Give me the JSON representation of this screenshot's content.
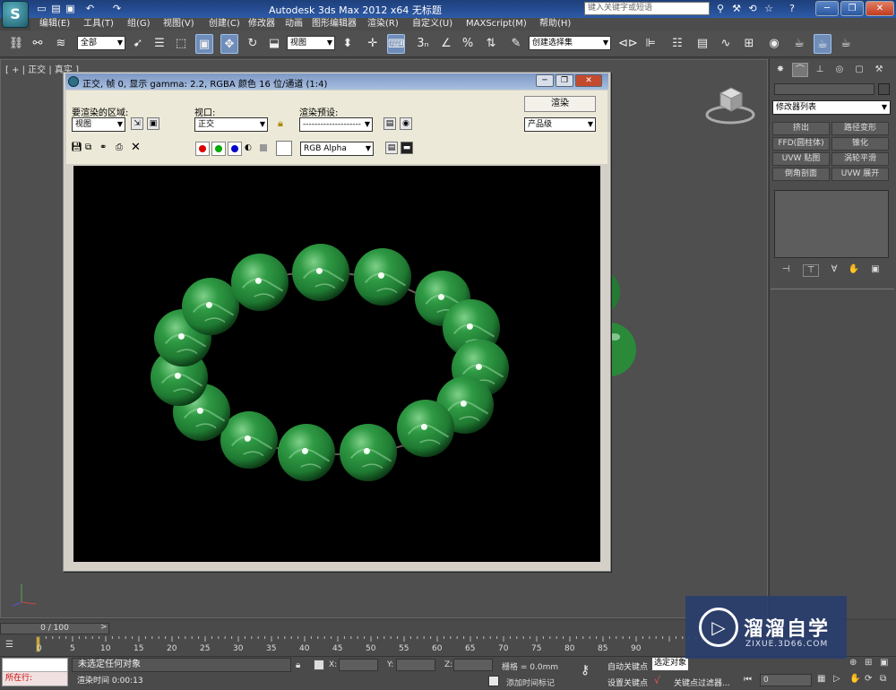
{
  "app": {
    "title": "Autodesk 3ds Max  2012 x64      无标题",
    "logo_text": "S",
    "search_placeholder": "键入关键字或短语"
  },
  "menus": [
    "编辑(E)",
    "工具(T)",
    "组(G)",
    "视图(V)",
    "创建(C)",
    "修改器",
    "动画",
    "图形编辑器",
    "渲染(R)",
    "自定义(U)",
    "MAXScript(M)",
    "帮助(H)"
  ],
  "toolbar": {
    "selection_filter": "全部",
    "ref_coord": "视图",
    "named_selection": "创建选择集"
  },
  "viewport": {
    "label": "[ + | 正交 | 真实 ]"
  },
  "render_frame": {
    "title": "正交, 帧 0, 显示 gamma: 2.2, RGBA 颜色 16 位/通道 (1:4)",
    "area_label": "要渲染的区域:",
    "area_value": "视图",
    "viewport_label": "视口:",
    "viewport_value": "正交",
    "preset_label": "渲染预设:",
    "preset_value": "--------------------",
    "render_button": "渲染",
    "production_value": "产品级",
    "channel_value": "RGB Alpha",
    "channel_colors": [
      "#dd0000",
      "#00a000",
      "#0000cc"
    ]
  },
  "command_panel": {
    "modifier_list": "修改器列表",
    "modifiers": [
      "挤出",
      "路径变形",
      "FFD(圆柱体)",
      "锥化",
      "UVW 贴图",
      "涡轮平滑",
      "倒角剖面",
      "UVW 展开"
    ]
  },
  "timeline": {
    "slider": "0 / 100",
    "ticks": [
      "0",
      "5",
      "10",
      "15",
      "20",
      "25",
      "30",
      "35",
      "40",
      "45",
      "50",
      "55",
      "60",
      "65",
      "70",
      "75",
      "80",
      "85",
      "90"
    ]
  },
  "status": {
    "maxscript": "所在行:",
    "selection_text": "未选定任何对象",
    "render_time": "渲染时间  0:00:13",
    "x_label": "X:",
    "y_label": "Y:",
    "z_label": "Z:",
    "grid": "栅格 = 0.0mm",
    "add_time_tag": "添加时间标记",
    "auto_key": "自动关键点",
    "set_key": "设置关键点",
    "selected": "选定对象",
    "key_filters": "关键点过滤器...",
    "frame": "0"
  },
  "watermark": {
    "title": "溜溜自学",
    "url": "ZIXUE.3D66.COM"
  },
  "colors": {
    "jade": "#2a8a3a",
    "ui_bg": "#4f4f4f",
    "title_blue": "#2d5aa8"
  }
}
